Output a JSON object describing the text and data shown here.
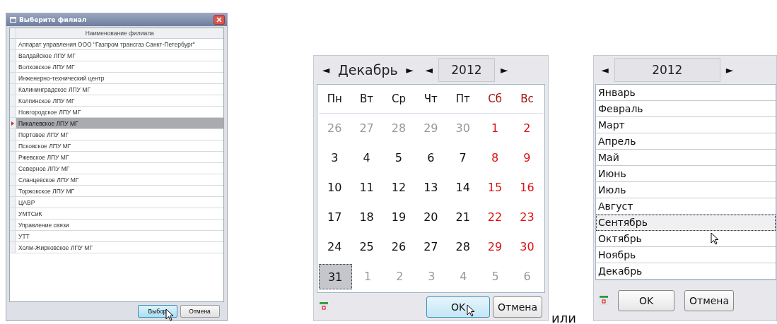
{
  "branch_dialog": {
    "title": "Выберите филиал",
    "column_header": "Наименование филиала",
    "rows": [
      {
        "name": "Аппарат управления ООО \"Газпром трансгаз Санкт-Петербург\"",
        "selected": false
      },
      {
        "name": "Валдайское ЛПУ МГ",
        "selected": false
      },
      {
        "name": "Волховское ЛПУ МГ",
        "selected": false
      },
      {
        "name": "Инженерно-технический центр",
        "selected": false
      },
      {
        "name": "Калининградское ЛПУ МГ",
        "selected": false
      },
      {
        "name": "Колпинское ЛПУ МГ",
        "selected": false
      },
      {
        "name": "Новгородское ЛПУ МГ",
        "selected": false
      },
      {
        "name": "Пикалевское ЛПУ МГ",
        "selected": true
      },
      {
        "name": "Портовое ЛПУ МГ",
        "selected": false
      },
      {
        "name": "Псковское ЛПУ МГ",
        "selected": false
      },
      {
        "name": "Ржевское ЛПУ МГ",
        "selected": false
      },
      {
        "name": "Северное ЛПУ МГ",
        "selected": false
      },
      {
        "name": "Сланцевское ЛПУ МГ",
        "selected": false
      },
      {
        "name": "Торжокское ЛПУ МГ",
        "selected": false
      },
      {
        "name": "ЦАВР",
        "selected": false
      },
      {
        "name": "УМТСиК",
        "selected": false
      },
      {
        "name": "Управление связи",
        "selected": false
      },
      {
        "name": "УТТ",
        "selected": false
      },
      {
        "name": "Холм-Жирковское ЛПУ МГ",
        "selected": false
      }
    ],
    "buttons": [
      {
        "label": "Выбор",
        "hovered": true
      },
      {
        "label": "Отмена",
        "hovered": false
      }
    ]
  },
  "calendar": {
    "prev_month": "◄",
    "month": "Декабрь",
    "next_month": "►",
    "prev_year": "◄",
    "year": "2012",
    "next_year": "►",
    "weekdays": [
      {
        "label": "Пн",
        "weekend": false
      },
      {
        "label": "Вт",
        "weekend": false
      },
      {
        "label": "Ср",
        "weekend": false
      },
      {
        "label": "Чт",
        "weekend": false
      },
      {
        "label": "Пт",
        "weekend": false
      },
      {
        "label": "Сб",
        "weekend": true
      },
      {
        "label": "Вс",
        "weekend": true
      }
    ],
    "days": [
      {
        "label": "26",
        "kind": "other",
        "selected": false
      },
      {
        "label": "27",
        "kind": "other",
        "selected": false
      },
      {
        "label": "28",
        "kind": "other",
        "selected": false
      },
      {
        "label": "29",
        "kind": "other",
        "selected": false
      },
      {
        "label": "30",
        "kind": "other",
        "selected": false
      },
      {
        "label": "1",
        "kind": "current",
        "weekend": true,
        "selected": false
      },
      {
        "label": "2",
        "kind": "current",
        "weekend": true,
        "selected": false
      },
      {
        "label": "3",
        "kind": "current",
        "weekend": false,
        "selected": false
      },
      {
        "label": "4",
        "kind": "current",
        "weekend": false,
        "selected": false
      },
      {
        "label": "5",
        "kind": "current",
        "weekend": false,
        "selected": false
      },
      {
        "label": "6",
        "kind": "current",
        "weekend": false,
        "selected": false
      },
      {
        "label": "7",
        "kind": "current",
        "weekend": false,
        "selected": false
      },
      {
        "label": "8",
        "kind": "current",
        "weekend": true,
        "selected": false
      },
      {
        "label": "9",
        "kind": "current",
        "weekend": true,
        "selected": false
      },
      {
        "label": "10",
        "kind": "current",
        "weekend": false,
        "selected": false
      },
      {
        "label": "11",
        "kind": "current",
        "weekend": false,
        "selected": false
      },
      {
        "label": "12",
        "kind": "current",
        "weekend": false,
        "selected": false
      },
      {
        "label": "13",
        "kind": "current",
        "weekend": false,
        "selected": false
      },
      {
        "label": "14",
        "kind": "current",
        "weekend": false,
        "selected": false
      },
      {
        "label": "15",
        "kind": "current",
        "weekend": true,
        "selected": false
      },
      {
        "label": "16",
        "kind": "current",
        "weekend": true,
        "selected": false
      },
      {
        "label": "17",
        "kind": "current",
        "weekend": false,
        "selected": false
      },
      {
        "label": "18",
        "kind": "current",
        "weekend": false,
        "selected": false
      },
      {
        "label": "19",
        "kind": "current",
        "weekend": false,
        "selected": false
      },
      {
        "label": "20",
        "kind": "current",
        "weekend": false,
        "selected": false
      },
      {
        "label": "21",
        "kind": "current",
        "weekend": false,
        "selected": false
      },
      {
        "label": "22",
        "kind": "current",
        "weekend": true,
        "selected": false
      },
      {
        "label": "23",
        "kind": "current",
        "weekend": true,
        "selected": false
      },
      {
        "label": "24",
        "kind": "current",
        "weekend": false,
        "selected": false
      },
      {
        "label": "25",
        "kind": "current",
        "weekend": false,
        "selected": false
      },
      {
        "label": "26",
        "kind": "current",
        "weekend": false,
        "selected": false
      },
      {
        "label": "27",
        "kind": "current",
        "weekend": false,
        "selected": false
      },
      {
        "label": "28",
        "kind": "current",
        "weekend": false,
        "selected": false
      },
      {
        "label": "29",
        "kind": "current",
        "weekend": true,
        "selected": false
      },
      {
        "label": "30",
        "kind": "current",
        "weekend": true,
        "selected": false
      },
      {
        "label": "31",
        "kind": "current",
        "weekend": false,
        "selected": true
      },
      {
        "label": "1",
        "kind": "other",
        "selected": false
      },
      {
        "label": "2",
        "kind": "other",
        "selected": false
      },
      {
        "label": "3",
        "kind": "other",
        "selected": false
      },
      {
        "label": "4",
        "kind": "other",
        "selected": false
      },
      {
        "label": "5",
        "kind": "other",
        "selected": false
      },
      {
        "label": "6",
        "kind": "other",
        "selected": false
      }
    ],
    "buttons": [
      {
        "label": "OK",
        "hovered": true
      },
      {
        "label": "Отмена",
        "hovered": false
      }
    ]
  },
  "separator_text": "или",
  "month_picker": {
    "prev_year": "◄",
    "year": "2012",
    "next_year": "►",
    "months": [
      {
        "label": "Январь",
        "selected": false
      },
      {
        "label": "Февраль",
        "selected": false
      },
      {
        "label": "Март",
        "selected": false
      },
      {
        "label": "Апрель",
        "selected": false
      },
      {
        "label": "Май",
        "selected": false
      },
      {
        "label": "Июнь",
        "selected": false
      },
      {
        "label": "Июль",
        "selected": false
      },
      {
        "label": "Август",
        "selected": false
      },
      {
        "label": "Сентябрь",
        "selected": true
      },
      {
        "label": "Октябрь",
        "selected": false
      },
      {
        "label": "Ноябрь",
        "selected": false
      },
      {
        "label": "Декабрь",
        "selected": false
      }
    ],
    "buttons": [
      {
        "label": "OK",
        "hovered": false
      },
      {
        "label": "Отмена",
        "hovered": false
      }
    ]
  }
}
